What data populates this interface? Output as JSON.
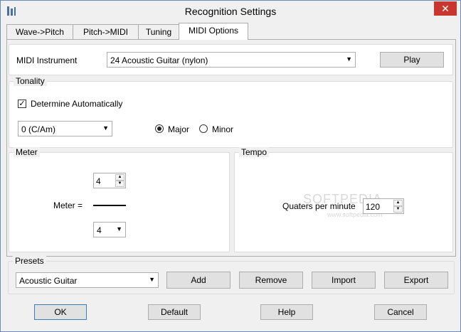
{
  "window": {
    "title": "Recognition Settings",
    "close_glyph": "✕"
  },
  "tabs": [
    {
      "label": "Wave->Pitch",
      "active": false
    },
    {
      "label": "Pitch->MIDI",
      "active": false
    },
    {
      "label": "Tuning",
      "active": false
    },
    {
      "label": "MIDI Options",
      "active": true
    }
  ],
  "instrument": {
    "label": "MIDI Instrument",
    "value": "24 Acoustic Guitar (nylon)",
    "play_label": "Play"
  },
  "tonality": {
    "group_label": "Tonality",
    "auto_label": "Determine Automatically",
    "auto_checked": true,
    "key_value": "0 (C/Am)",
    "major_label": "Major",
    "minor_label": "Minor",
    "mode_selected": "Major"
  },
  "meter": {
    "group_label": "Meter",
    "label": "Meter  =",
    "numerator": "4",
    "denominator": "4"
  },
  "tempo": {
    "group_label": "Tempo",
    "label": "Quaters per minute",
    "value": "120"
  },
  "presets": {
    "group_label": "Presets",
    "value": "Acoustic Guitar",
    "add_label": "Add",
    "remove_label": "Remove",
    "import_label": "Import",
    "export_label": "Export"
  },
  "footer": {
    "ok_label": "OK",
    "default_label": "Default",
    "help_label": "Help",
    "cancel_label": "Cancel"
  },
  "watermark": {
    "line1": "SOFTPEDIA",
    "line2": "www.softpedia.com"
  },
  "icons": [
    "app-icon",
    "close-icon",
    "dropdown-arrow-icon",
    "spin-up-icon",
    "spin-down-icon",
    "checkmark-icon"
  ]
}
